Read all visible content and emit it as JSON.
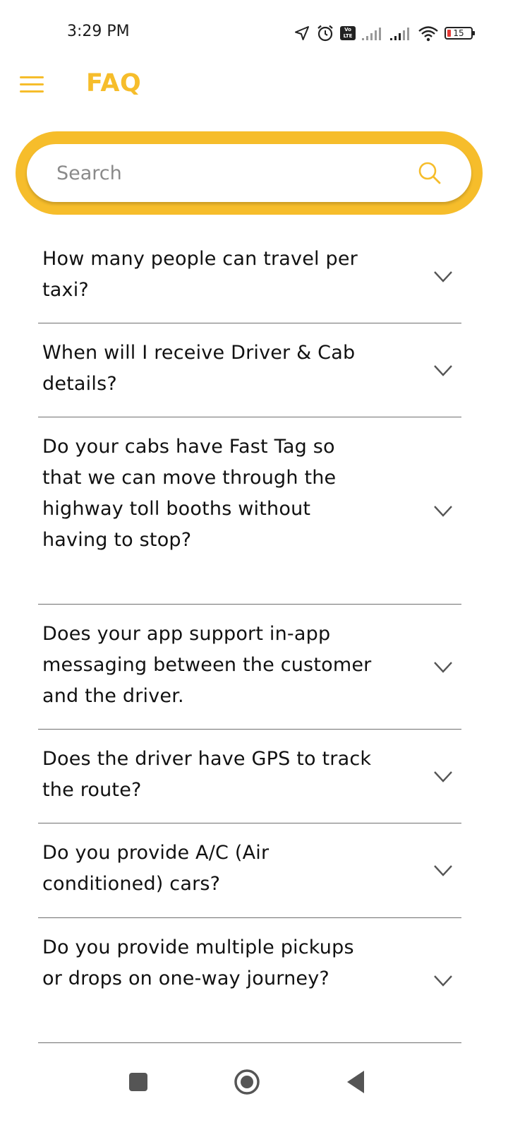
{
  "status_bar": {
    "time": "3:29 PM",
    "battery_level": "15",
    "volte_label": "Vo LTE",
    "icons": [
      "location-icon",
      "alarm-icon",
      "volte-icon",
      "signal-icon",
      "signal-icon",
      "wifi-icon",
      "battery-icon"
    ]
  },
  "header": {
    "title": "FAQ",
    "menu_icon": "hamburger-menu-icon"
  },
  "search": {
    "placeholder": "Search",
    "value": "",
    "icon": "search-icon"
  },
  "faq": {
    "items": [
      {
        "question": "How many people can travel per taxi?"
      },
      {
        "question": "When will I receive Driver & Cab details?"
      },
      {
        "question": "Do your cabs have Fast Tag so that we can move through the highway toll booths without having to stop?"
      },
      {
        "question": "Does your app support in-app messaging between the customer and the driver."
      },
      {
        "question": "Does the driver have GPS to track the route?"
      },
      {
        "question": "Do you provide A/C (Air conditioned) cars?"
      },
      {
        "question": "Do you provide multiple pickups or drops on one-way journey?"
      }
    ]
  },
  "nav_bar": {
    "buttons": [
      "recents-square-icon",
      "home-circle-icon",
      "back-triangle-icon"
    ]
  },
  "colors": {
    "accent": "#f6bd2b",
    "text": "#111111",
    "divider": "#6f6f6f",
    "battery_low": "#e53935"
  }
}
